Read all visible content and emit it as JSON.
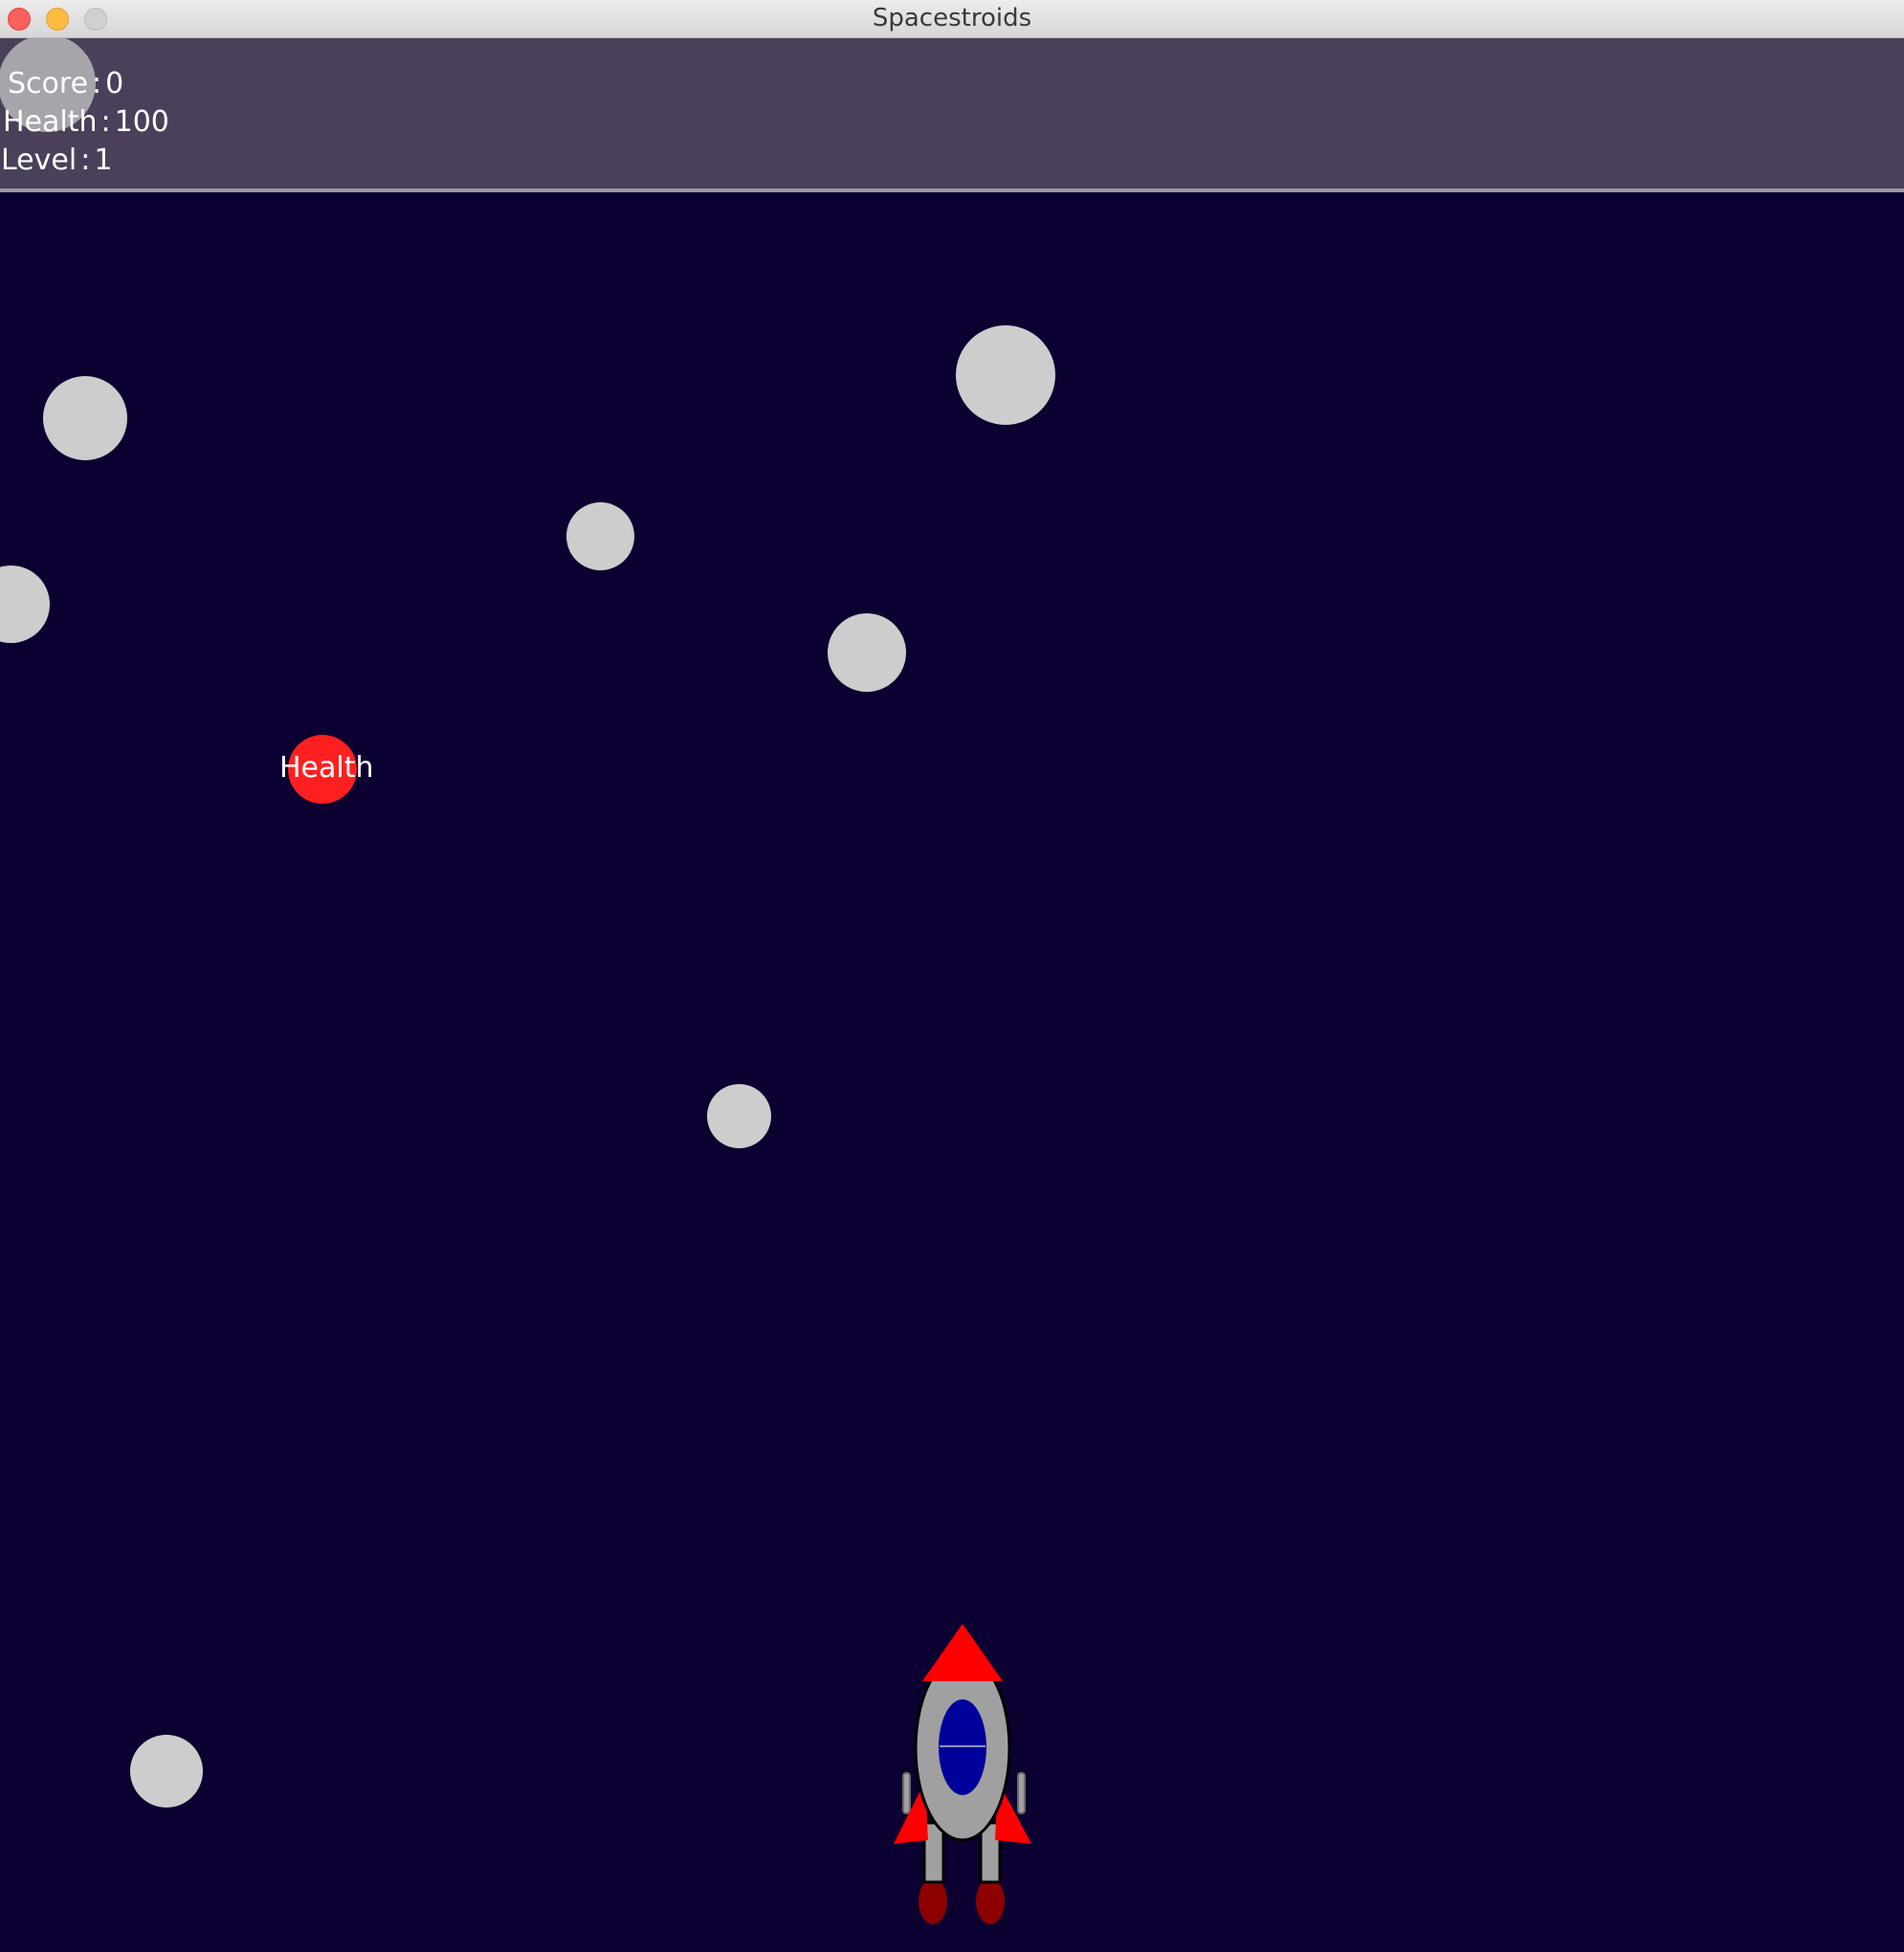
{
  "window": {
    "title": "Spacestroids"
  },
  "hud": {
    "score_label": "Score",
    "score_value": "0",
    "health_label": "Health",
    "health_value": "100",
    "level_label": "Level",
    "level_value": "1"
  },
  "powerup": {
    "label": "Health"
  },
  "colors": {
    "background": "#0c0030",
    "hud_background": "#4a4059",
    "asteroid": "#cdcdcd",
    "powerup": "#fe2020",
    "ship_body": "#a0a0a0",
    "ship_accent": "#ff0000",
    "ship_window": "#00009a",
    "ship_flame": "#8c0000"
  }
}
